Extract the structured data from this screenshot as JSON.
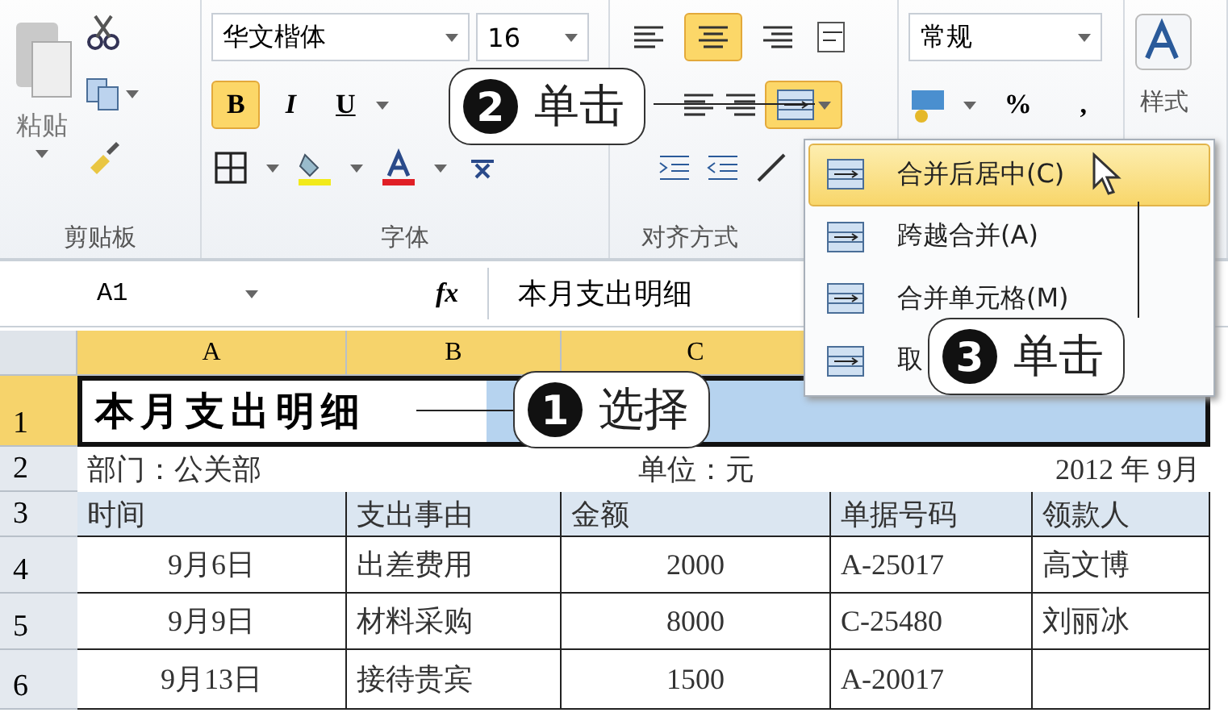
{
  "ribbon": {
    "clipboard": {
      "paste_label": "粘贴",
      "group_label": "剪贴板"
    },
    "font": {
      "family": "华文楷体",
      "size": "16",
      "styles": [
        {
          "label": "B",
          "selected": true
        },
        {
          "label": "I",
          "selected": false
        },
        {
          "label": "U",
          "selected": false
        }
      ],
      "group_label": "字体"
    },
    "alignment": {
      "align_buttons": [
        {
          "selected": false
        },
        {
          "selected": true
        },
        {
          "selected": false
        }
      ],
      "merge_selected": true,
      "group_label": "对齐方式"
    },
    "number": {
      "format": "常规",
      "percent": "%",
      "comma": ","
    },
    "styles": {
      "label": "样式"
    }
  },
  "formula_bar": {
    "cell": "A1",
    "fx": "fx",
    "value": "本月支出明细"
  },
  "sheet": {
    "columns": [
      {
        "label": "A",
        "selected": true
      },
      {
        "label": "B",
        "selected": true
      },
      {
        "label": "C",
        "selected": true
      }
    ],
    "rows": [
      {
        "number": "1",
        "selected": true,
        "kind": "title",
        "title": "本月支出明细"
      },
      {
        "number": "2",
        "selected": false,
        "kind": "info",
        "left": "部门：公关部",
        "middle": "单位：元",
        "right": "2012 年 9月"
      },
      {
        "number": "3",
        "selected": false,
        "kind": "header",
        "cells": [
          "时间",
          "支出事由",
          "金额",
          "单据号码",
          "领款人"
        ]
      },
      {
        "number": "4",
        "selected": false,
        "kind": "data",
        "cells": [
          "9月6日",
          "出差费用",
          "2000",
          "A-25017",
          "高文博"
        ]
      },
      {
        "number": "5",
        "selected": false,
        "kind": "data",
        "cells": [
          "9月9日",
          "材料采购",
          "8000",
          "C-25480",
          "刘丽冰"
        ]
      },
      {
        "number": "6",
        "selected": false,
        "kind": "data",
        "cells": [
          "9月13日",
          "接待贵宾",
          "1500",
          "A-20017"
        ]
      }
    ]
  },
  "merge_menu": [
    {
      "label": "合并后居中(C)",
      "selected": true
    },
    {
      "label": "跨越合并(A)",
      "selected": false
    },
    {
      "label": "合并单元格(M)",
      "selected": false
    },
    {
      "label": "取",
      "selected": false
    }
  ],
  "callouts": [
    {
      "number": "1",
      "text": "选择"
    },
    {
      "number": "2",
      "text": "单击"
    },
    {
      "number": "3",
      "text": "单击"
    }
  ]
}
